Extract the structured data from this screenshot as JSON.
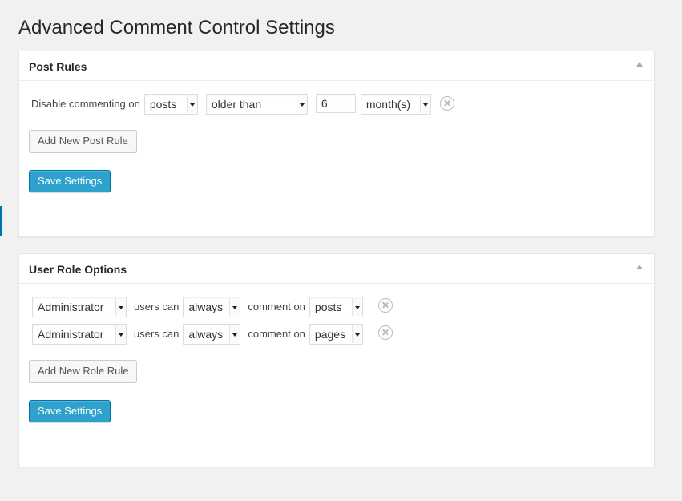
{
  "page": {
    "title": "Advanced Comment Control Settings"
  },
  "post_rules": {
    "title": "Post Rules",
    "rule": {
      "prefix": "Disable commenting on",
      "post_type": "posts",
      "condition": "older than",
      "amount": "6",
      "unit": "month(s)"
    },
    "add_button": "Add New Post Rule",
    "save_button": "Save Settings"
  },
  "role_options": {
    "title": "User Role Options",
    "rules": [
      {
        "role": "Administrator",
        "users_can_label": "users can",
        "permission": "always",
        "comment_on_label": "comment on",
        "post_type": "posts"
      },
      {
        "role": "Administrator",
        "users_can_label": "users can",
        "permission": "always",
        "comment_on_label": "comment on",
        "post_type": "pages"
      }
    ],
    "add_button": "Add New Role Rule",
    "save_button": "Save Settings"
  },
  "colors": {
    "primary_button": "#2ea2cc",
    "background": "#f1f1f1"
  },
  "icons": {
    "remove": "remove-circle-icon",
    "toggle": "collapse-triangle-icon",
    "dropdown": "dropdown-arrow-icon"
  }
}
